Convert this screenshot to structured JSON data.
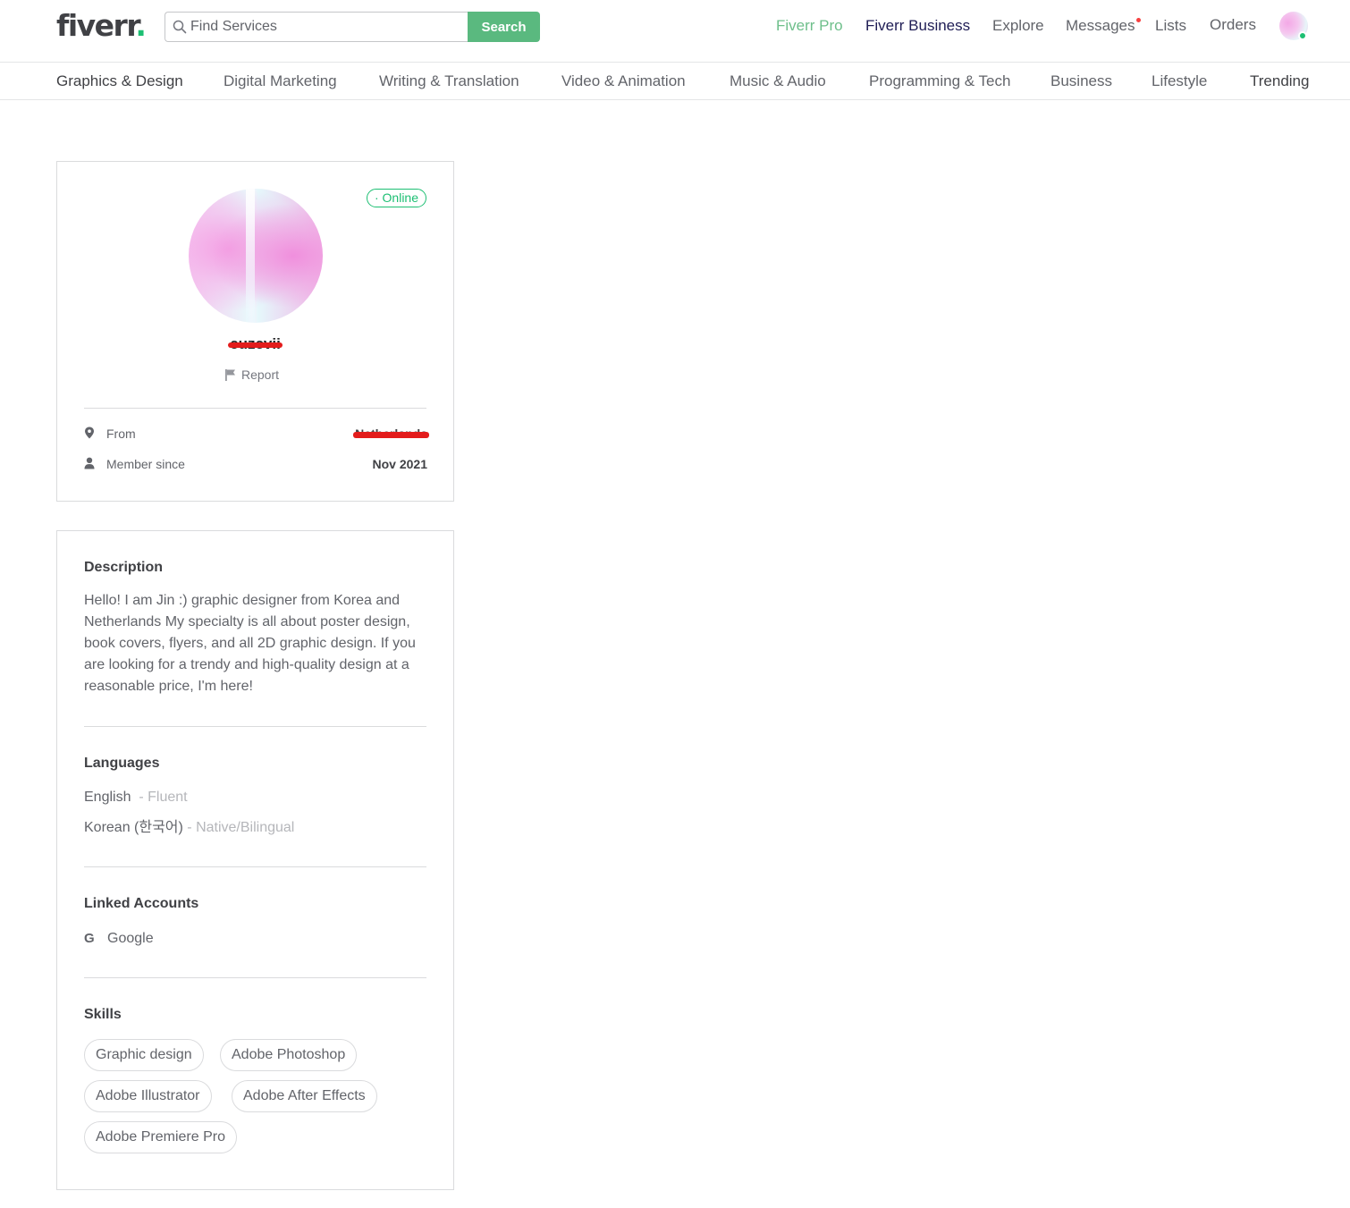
{
  "header": {
    "logo_text": "fiverr",
    "logo_dot": ".",
    "search_placeholder": "Find Services",
    "search_button": "Search",
    "nav": {
      "pro": "Fiverr Pro",
      "business": "Fiverr Business",
      "explore": "Explore",
      "messages": "Messages",
      "lists": "Lists",
      "orders": "Orders"
    }
  },
  "categories": [
    "Graphics & Design",
    "Digital Marketing",
    "Writing & Translation",
    "Video & Animation",
    "Music & Audio",
    "Programming & Tech",
    "Business",
    "Lifestyle",
    "Trending"
  ],
  "profile": {
    "status": "· Online",
    "username": "cuzcvii",
    "report": "Report",
    "from_label": "From",
    "from_value": "Netherlands",
    "member_label": "Member since",
    "member_value": "Nov 2021"
  },
  "info": {
    "description_title": "Description",
    "description": "Hello! I am Jin :) graphic designer from Korea and Netherlands My specialty is all about poster design, book covers, flyers, and all 2D graphic design. If you are looking for a trendy and high-quality design at a reasonable price, I'm here!",
    "languages_title": "Languages",
    "languages": [
      {
        "name": "English",
        "sep": " - ",
        "level": "Fluent"
      },
      {
        "name": "Korean (한국어)",
        "sep": " - ",
        "level": "Native/Bilingual"
      }
    ],
    "linked_title": "Linked Accounts",
    "linked_accounts": [
      {
        "icon": "google-icon",
        "name": "Google"
      }
    ],
    "skills_title": "Skills",
    "skills": [
      "Graphic design",
      "Adobe Photoshop",
      "Adobe Illustrator",
      "Adobe After Effects",
      "Adobe Premiere Pro"
    ]
  },
  "colors": {
    "brand_green": "#1dbf73",
    "search_button": "#5ab97f",
    "pro_link": "#6ebf8b",
    "business_link": "#1f1d55",
    "notification_dot": "#f74040",
    "redaction": "#e31c1c"
  }
}
